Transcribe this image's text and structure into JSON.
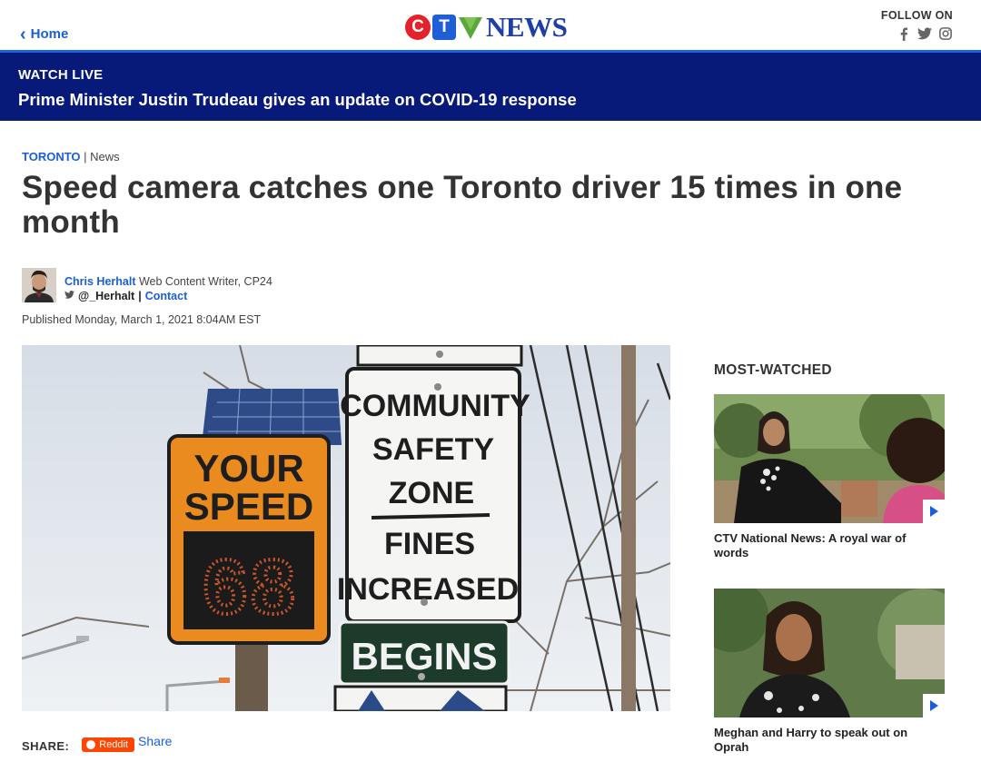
{
  "header": {
    "home_label": "Home",
    "logo_letters": [
      "C",
      "T",
      "V"
    ],
    "logo_word": "NEWS",
    "follow_label": "FOLLOW ON",
    "social_icons": [
      "facebook-icon",
      "twitter-icon",
      "instagram-icon"
    ]
  },
  "live": {
    "label": "WATCH LIVE",
    "title": "Prime Minister Justin Trudeau gives an update on COVID-19 response"
  },
  "article": {
    "section": "TORONTO",
    "separator": "|",
    "subsection": "News",
    "headline": "Speed camera catches one Toronto driver 15 times in one month",
    "author_name": "Chris Herhalt",
    "author_role": "Web Content Writer, CP24",
    "twitter_handle": "@_Herhalt",
    "contact_label": "Contact",
    "published": "Published Monday, March 1, 2021 8:04AM EST",
    "sign_your": "YOUR",
    "sign_speed": "SPEED",
    "sign_digits": "68",
    "sign_line1": "COMMUNITY",
    "sign_line2": "SAFETY",
    "sign_line3": "ZONE",
    "sign_line4": "FINES",
    "sign_line5": "INCREASED",
    "sign_begins": "BEGINS"
  },
  "share": {
    "label": "SHARE:",
    "reddit_label": "Reddit",
    "share_link": "Share"
  },
  "sidebar": {
    "title": "MOST-WATCHED",
    "cards": [
      {
        "caption": "CTV National News: A royal war of words"
      },
      {
        "caption": "Meghan and Harry to speak out on Oprah"
      }
    ]
  },
  "colors": {
    "brand_blue": "#1a5fd8",
    "live_banner": "#071a7a",
    "ctv_red": "#e4222b",
    "reddit_orange": "#ff4500"
  }
}
